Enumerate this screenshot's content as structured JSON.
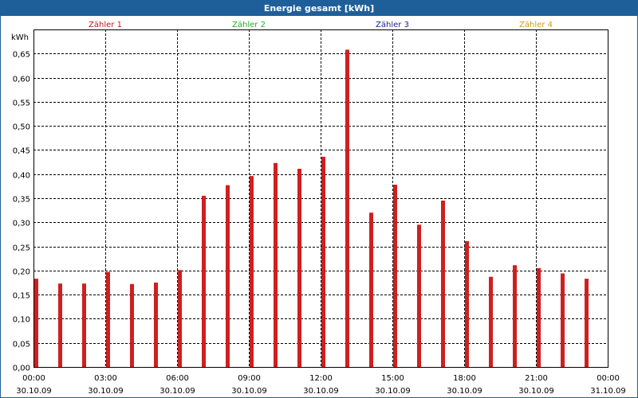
{
  "window": {
    "title": "Energie gesamt [kWh]"
  },
  "colors": {
    "titlebar": "#1f5f99",
    "bar": "#d01f1f",
    "grid": "#000000"
  },
  "chart_data": {
    "type": "bar",
    "title": "Energie gesamt [kWh]",
    "ylabel": "kWh",
    "ylim": [
      0,
      0.7
    ],
    "yticks": [
      "0,00",
      "0,05",
      "0,10",
      "0,15",
      "0,20",
      "0,25",
      "0,30",
      "0,35",
      "0,40",
      "0,45",
      "0,50",
      "0,55",
      "0,60",
      "0,65"
    ],
    "xrange_hours": [
      0,
      24
    ],
    "xticks": [
      {
        "time": "00:00",
        "date": "30.10.09"
      },
      {
        "time": "03:00",
        "date": "30.10.09"
      },
      {
        "time": "06:00",
        "date": "30.10.09"
      },
      {
        "time": "09:00",
        "date": "30.10.09"
      },
      {
        "time": "12:00",
        "date": "30.10.09"
      },
      {
        "time": "15:00",
        "date": "30.10.09"
      },
      {
        "time": "18:00",
        "date": "30.10.09"
      },
      {
        "time": "21:00",
        "date": "30.10.09"
      },
      {
        "time": "00:00",
        "date": "31.10.09"
      }
    ],
    "legend": [
      {
        "name": "Zähler 1",
        "color": "#c01818"
      },
      {
        "name": "Zähler 2",
        "color": "#20b020"
      },
      {
        "name": "Zähler 3",
        "color": "#20209a"
      },
      {
        "name": "Zähler 4",
        "color": "#d49a1a"
      }
    ],
    "legend_position": "top",
    "grid": true,
    "series": [
      {
        "name": "Zähler 1",
        "color": "#d01f1f",
        "x": [
          "00:00",
          "01:00",
          "02:00",
          "03:00",
          "04:00",
          "05:00",
          "06:00",
          "07:00",
          "08:00",
          "09:00",
          "10:00",
          "11:00",
          "12:00",
          "13:00",
          "14:00",
          "15:00",
          "16:00",
          "17:00",
          "18:00",
          "19:00",
          "20:00",
          "21:00",
          "22:00",
          "23:00"
        ],
        "values": [
          0.183,
          0.173,
          0.173,
          0.197,
          0.172,
          0.175,
          0.201,
          0.355,
          0.377,
          0.396,
          0.423,
          0.411,
          0.436,
          0.658,
          0.32,
          0.378,
          0.295,
          0.345,
          0.261,
          0.187,
          0.211,
          0.205,
          0.194,
          0.183
        ]
      }
    ]
  }
}
